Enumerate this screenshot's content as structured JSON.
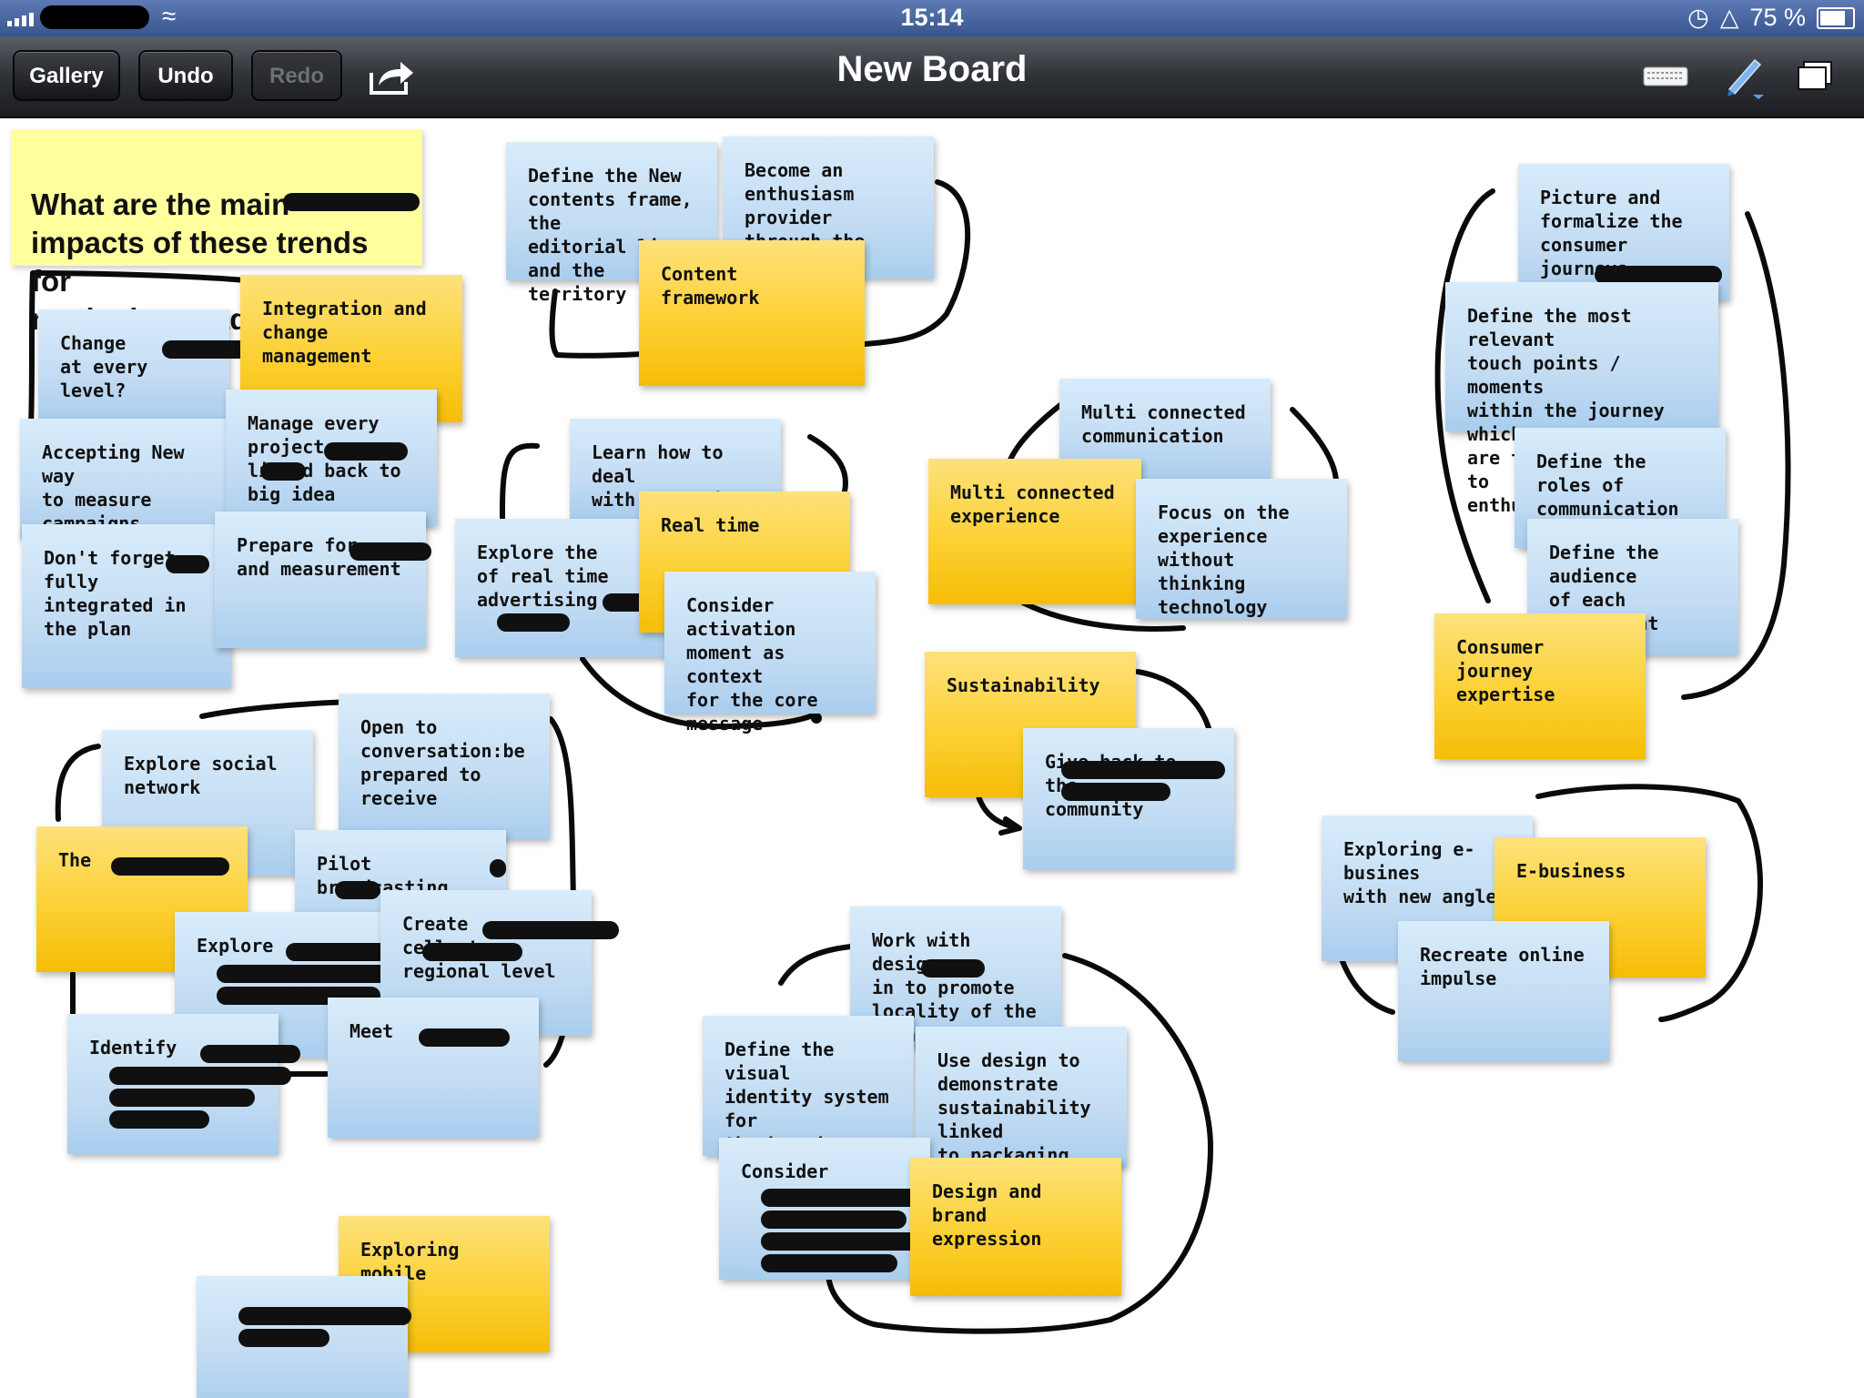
{
  "status_bar": {
    "time": "15:14",
    "battery": "75 %",
    "icons": [
      "signal-icon",
      "wifi-icon",
      "orientation-lock-icon",
      "airplay-icon",
      "battery-icon"
    ]
  },
  "toolbar": {
    "gallery_label": "Gallery",
    "undo_label": "Undo",
    "redo_label": "Redo",
    "title": "New Board",
    "icons": [
      "share-icon",
      "keyboard-icon",
      "pen-icon",
      "pages-icon"
    ]
  },
  "board": {
    "question": "What are the main impacts of these trends for\nmarketing roadmap?",
    "notes": [
      {
        "id": "change",
        "color": "blue",
        "text": "Change\nat every level?"
      },
      {
        "id": "integration",
        "color": "yellow",
        "text": "Integration and\nchange management"
      },
      {
        "id": "accepting",
        "color": "blue",
        "text": "Accepting New way\nto measure\ncampaigns"
      },
      {
        "id": "manage-every",
        "color": "blue",
        "text": "Manage every\nproject\n linked back to\nbig idea"
      },
      {
        "id": "dont-forget",
        "color": "blue",
        "text": "Don't forget\nfully integrated in\nthe plan"
      },
      {
        "id": "prepare-for",
        "color": "blue",
        "text": "Prepare for\nand measurement"
      },
      {
        "id": "define-new",
        "color": "blue",
        "text": "Define the New\ncontents frame, the\neditorial line and the\nterritory"
      },
      {
        "id": "become-enthusiasm",
        "color": "blue",
        "text": "Become an\nenthusiasm provider\nthrough the content"
      },
      {
        "id": "content-framework",
        "color": "yellow",
        "text": "Content framework"
      },
      {
        "id": "learn-real-time",
        "color": "blue",
        "text": "Learn how to deal\nwith real Time"
      },
      {
        "id": "explore-real-time",
        "color": "blue",
        "text": "Explore the\nof real time\nadvertising"
      },
      {
        "id": "real-time",
        "color": "yellow",
        "text": "Real time"
      },
      {
        "id": "consider-activation",
        "color": "blue",
        "text": "Consider activation\nmoment as context\nfor the core message"
      },
      {
        "id": "multi-connected-communication",
        "color": "blue",
        "text": "Multi connected\ncommunication"
      },
      {
        "id": "multi-connected-experience",
        "color": "yellow",
        "text": "Multi connected\nexperience"
      },
      {
        "id": "focus-experience",
        "color": "blue",
        "text": "Focus on the\nexperience without\nthinking technology"
      },
      {
        "id": "sustainability",
        "color": "yellow",
        "text": "Sustainability"
      },
      {
        "id": "give-back",
        "color": "blue",
        "text": "Give back to the\ncommunity"
      },
      {
        "id": "picture-formalize",
        "color": "blue",
        "text": "Picture and\nformalize  the\nconsumer journeys\nfor"
      },
      {
        "id": "define-touch-points",
        "color": "blue",
        "text": "Define the most relevant\ntouch points / moments\nwithin the journey which\nare the most relevant to\nenthusiasm"
      },
      {
        "id": "define-roles",
        "color": "blue",
        "text": "Define the roles of\ncommunication of\neach channel"
      },
      {
        "id": "define-audience",
        "color": "blue",
        "text": "Define the audience\nof each touchpoint"
      },
      {
        "id": "consumer-journey",
        "color": "yellow",
        "text": "Consumer journey\nexpertise"
      },
      {
        "id": "explore-social",
        "color": "blue",
        "text": "Explore social\nnetwork"
      },
      {
        "id": "open-conversation",
        "color": "blue",
        "text": "Open to\nconversation:be\nprepared to receive"
      },
      {
        "id": "the",
        "color": "yellow",
        "text": "The"
      },
      {
        "id": "pilot-broadcasting",
        "color": "blue",
        "text": "Pilot broadcasting"
      },
      {
        "id": "explore",
        "color": "blue",
        "text": "Explore"
      },
      {
        "id": "create",
        "color": "blue",
        "text": "Create\n cell at\nregional level"
      },
      {
        "id": "identify",
        "color": "blue",
        "text": "Identify"
      },
      {
        "id": "meet",
        "color": "blue",
        "text": "Meet"
      },
      {
        "id": "exploring-ebusiness",
        "color": "blue",
        "text": "Exploring e-busines\nwith new angles"
      },
      {
        "id": "ebusiness",
        "color": "yellow",
        "text": "E-business"
      },
      {
        "id": "recreate-online",
        "color": "blue",
        "text": "Recreate online\nimpulse"
      },
      {
        "id": "work-designer",
        "color": "blue",
        "text": "Work with designer\nin  to promote\nlocality of the brand"
      },
      {
        "id": "define-visual",
        "color": "blue",
        "text": "Define the visual\nidentity system for\nthe brand (style\nguide)"
      },
      {
        "id": "use-design",
        "color": "blue",
        "text": "Use design to\ndemonstrate\nsustainability linked\nto packaging"
      },
      {
        "id": "consider",
        "color": "blue",
        "text": "Consider"
      },
      {
        "id": "design-brand",
        "color": "yellow",
        "text": "Design and brand\nexpression"
      },
      {
        "id": "exploring-mobile",
        "color": "yellow",
        "text": "Exploring mobile"
      },
      {
        "id": "mobile-sub",
        "color": "blue",
        "text": ""
      }
    ]
  }
}
